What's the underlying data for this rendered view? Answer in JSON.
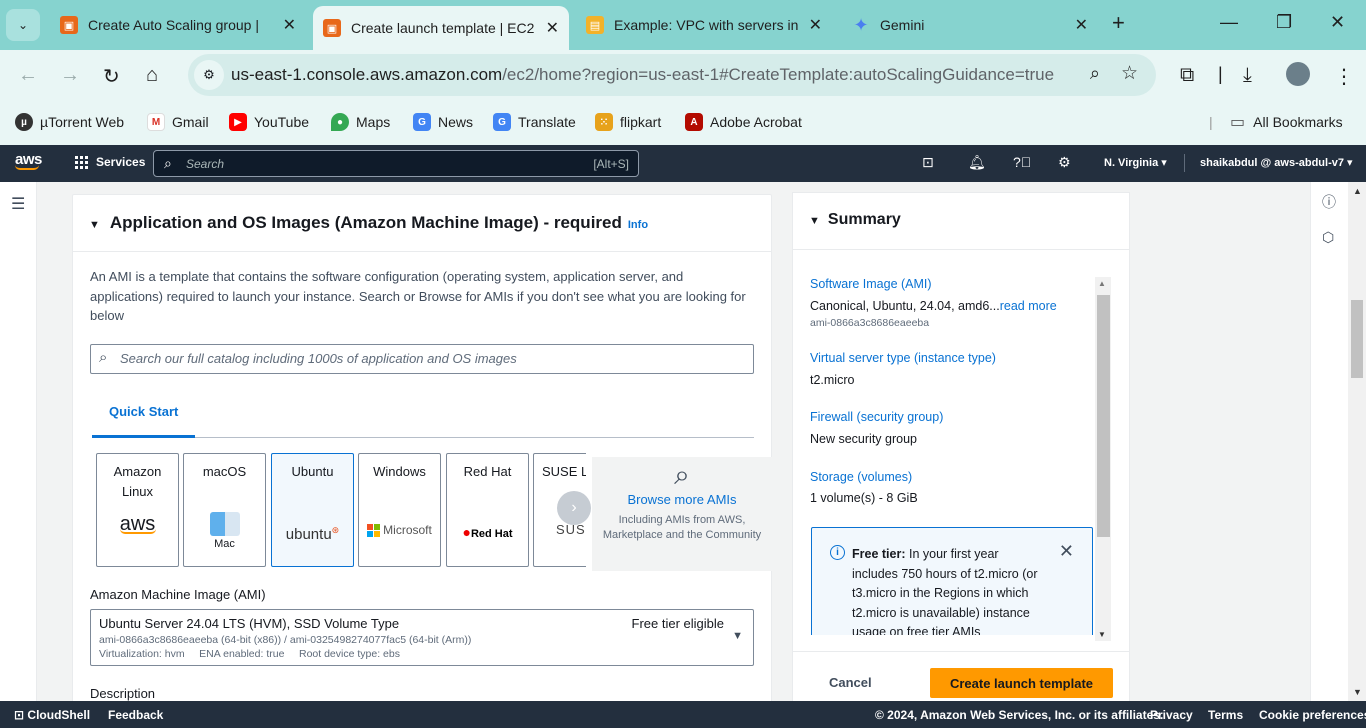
{
  "browser": {
    "tabs": [
      {
        "title": "Create Auto Scaling group |",
        "icon": "aws-ec2-icon"
      },
      {
        "title": "Create launch template | EC2",
        "icon": "aws-ec2-icon"
      },
      {
        "title": "Example: VPC with servers in",
        "icon": "aws-docs-icon"
      },
      {
        "title": "Gemini",
        "icon": "gemini-icon"
      }
    ],
    "url_host": "us-east-1.console.aws.amazon.com",
    "url_path": "/ec2/home?region=us-east-1#CreateTemplate:autoScalingGuidance=true",
    "bookmarks": [
      "µTorrent Web",
      "Gmail",
      "YouTube",
      "Maps",
      "News",
      "Translate",
      "flipkart",
      "Adobe Acrobat"
    ],
    "all_bookmarks": "All Bookmarks"
  },
  "aws_header": {
    "logo": "aws",
    "services": "Services",
    "search_placeholder": "Search",
    "search_shortcut": "[Alt+S]",
    "region": "N. Virginia",
    "account": "shaikabdul @ aws-abdul-v7"
  },
  "ami_section": {
    "title": "Application and OS Images (Amazon Machine Image) - required",
    "info": "Info",
    "description": "An AMI is a template that contains the software configuration (operating system, application server, and applications) required to launch your instance. Search or Browse for AMIs if you don't see what you are looking for below",
    "search_placeholder": "Search our full catalog including 1000s of application and OS images",
    "tab": "Quick Start",
    "os_cards": [
      {
        "line1": "Amazon",
        "line2": "Linux",
        "logo": "aws"
      },
      {
        "line1": "macOS",
        "line2": "",
        "logo": "Mac"
      },
      {
        "line1": "Ubuntu",
        "line2": "",
        "logo": "ubuntu"
      },
      {
        "line1": "Windows",
        "line2": "",
        "logo": "Microsoft"
      },
      {
        "line1": "Red Hat",
        "line2": "",
        "logo": "Red Hat"
      },
      {
        "line1": "SUSE L",
        "line2": "",
        "logo": "SUS"
      }
    ],
    "browse_more": "Browse more AMIs",
    "browse_sub": "Including AMIs from AWS, Marketplace and the Community",
    "ami_label": "Amazon Machine Image (AMI)",
    "ami_name": "Ubuntu Server 24.04 LTS (HVM), SSD Volume Type",
    "ami_badge": "Free tier eligible",
    "ami_ids": "ami-0866a3c8686eaeeba (64-bit (x86)) / ami-0325498274077fac5 (64-bit (Arm))",
    "ami_meta": "Virtualization: hvm     ENA enabled: true     Root device type: ebs",
    "description_label": "Description"
  },
  "summary": {
    "title": "Summary",
    "software_image_label": "Software Image (AMI)",
    "software_image_value": "Canonical, Ubuntu, 24.04, amd6...",
    "read_more": "read more",
    "software_image_id": "ami-0866a3c8686eaeeba",
    "instance_type_label": "Virtual server type (instance type)",
    "instance_type_value": "t2.micro",
    "firewall_label": "Firewall (security group)",
    "firewall_value": "New security group",
    "storage_label": "Storage (volumes)",
    "storage_value": "1 volume(s) - 8 GiB",
    "free_tier_bold": "Free tier:",
    "free_tier_text": " In your first year includes 750 hours of t2.micro (or t3.micro in the Regions in which t2.micro is unavailable) instance usage on free tier AMIs",
    "cancel": "Cancel",
    "create": "Create launch template"
  },
  "footer": {
    "cloudshell": "CloudShell",
    "feedback": "Feedback",
    "copyright": "© 2024, Amazon Web Services, Inc. or its affiliates.",
    "privacy": "Privacy",
    "terms": "Terms",
    "cookies": "Cookie preferences"
  },
  "colors": {
    "accent": "#0972d3",
    "primary_button": "#ff9900",
    "aws_header": "#232f3e",
    "browser_frame": "#86d3cf"
  }
}
